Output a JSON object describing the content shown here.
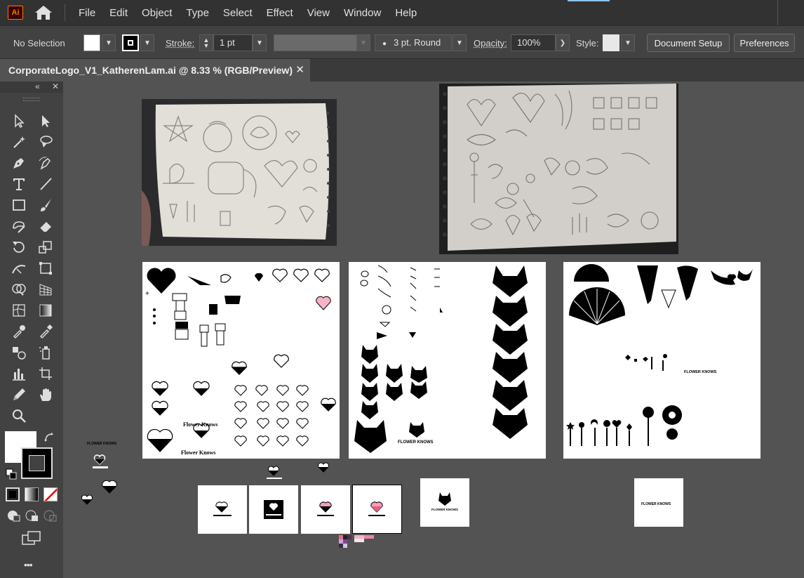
{
  "app": {
    "logo_text": "Ai"
  },
  "menus": [
    "File",
    "Edit",
    "Object",
    "Type",
    "Select",
    "Effect",
    "View",
    "Window",
    "Help"
  ],
  "control_bar": {
    "selection_status": "No Selection",
    "stroke_label": "Stroke:",
    "stroke_value": "1 pt",
    "brush_value": "3 pt. Round",
    "opacity_label": "Opacity:",
    "opacity_value": "100%",
    "style_label": "Style:",
    "document_setup": "Document Setup",
    "preferences": "Preferences"
  },
  "document_tab": {
    "title": "CorporateLogo_V1_KatherenLam.ai @ 8.33 % (RGB/Preview)",
    "close_glyph": "✕"
  },
  "toolbar": {
    "collapse_glyph": "«",
    "close_glyph": "✕",
    "more_glyph": "•••",
    "tools": [
      "selection-tool",
      "direct-selection-tool",
      "magic-wand-tool",
      "lasso-tool",
      "pen-tool",
      "curvature-tool",
      "type-tool",
      "line-tool",
      "rectangle-tool",
      "paintbrush-tool",
      "shaper-tool",
      "eraser-tool",
      "rotate-tool",
      "scale-tool",
      "width-tool",
      "free-transform-tool",
      "shape-builder-tool",
      "perspective-grid-tool",
      "mesh-tool",
      "gradient-tool",
      "eyedropper-tool",
      "eyedropper-2-tool",
      "blend-tool",
      "symbol-sprayer-tool",
      "column-graph-tool",
      "artboard-tool",
      "pencil-tool",
      "hand-tool",
      "zoom-tool"
    ]
  },
  "artwork": {
    "brand_text": "Flower Knows",
    "brand_text_caps": "FLOWER KNOWS"
  },
  "colors": {
    "menubar": "#323232",
    "panel": "#424242",
    "canvas": "#535353",
    "ai_orange": "#ff7c00"
  }
}
